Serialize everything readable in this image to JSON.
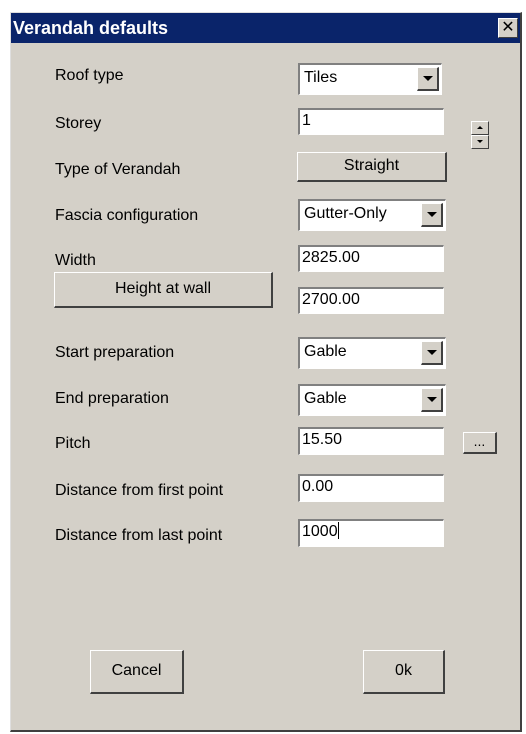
{
  "window": {
    "title": "Verandah defaults",
    "close_glyph": "✕"
  },
  "fields": {
    "roof_type": {
      "label": "Roof type",
      "value": "Tiles"
    },
    "storey": {
      "label": "Storey",
      "value": "1"
    },
    "verandah_type": {
      "label": "Type of Verandah",
      "value": "Straight"
    },
    "fascia": {
      "label": "Fascia configuration",
      "value": "Gutter-Only"
    },
    "width": {
      "label": "Width",
      "value": "2825.00"
    },
    "height_at_wall": {
      "label": "Height at wall",
      "value": "2700.00"
    },
    "start_prep": {
      "label": "Start preparation",
      "value": "Gable"
    },
    "end_prep": {
      "label": "End preparation",
      "value": "Gable"
    },
    "pitch": {
      "label": "Pitch",
      "value": "15.50",
      "button_label": "..."
    },
    "dist_first": {
      "label": "Distance from first point",
      "value": "0.00"
    },
    "dist_last": {
      "label": "Distance from last point",
      "value": "1000"
    }
  },
  "buttons": {
    "cancel": "Cancel",
    "ok": "0k"
  },
  "icons": {
    "close": "close-icon",
    "dropdown": "chevron-down-icon",
    "spinner": "spin-updown-icon"
  }
}
